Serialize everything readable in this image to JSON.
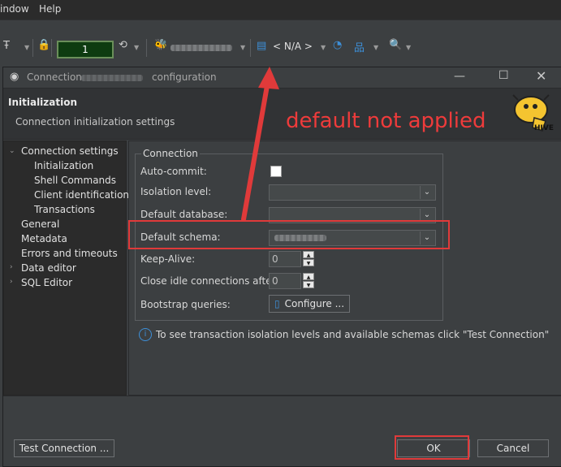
{
  "menu": {
    "items": [
      "indow",
      "Help"
    ]
  },
  "toolbar": {
    "counter_value": "1",
    "schema_label": "< N/A >"
  },
  "dialog": {
    "title_prefix": "Connection",
    "title_suffix": "configuration",
    "header_title": "Initialization",
    "header_subtitle": "Connection initialization settings",
    "logo_text": "HIVE"
  },
  "nav": {
    "items": [
      {
        "label": "Connection settings"
      },
      {
        "label": "Initialization"
      },
      {
        "label": "Shell Commands"
      },
      {
        "label": "Client identification"
      },
      {
        "label": "Transactions"
      },
      {
        "label": "General"
      },
      {
        "label": "Metadata"
      },
      {
        "label": "Errors and timeouts"
      },
      {
        "label": "Data editor"
      },
      {
        "label": "SQL Editor"
      }
    ]
  },
  "connection": {
    "group_label": "Connection",
    "auto_commit_label": "Auto-commit:",
    "isolation_label": "Isolation level:",
    "default_database_label": "Default database:",
    "default_schema_label": "Default schema:",
    "keepalive_label": "Keep-Alive:",
    "keepalive_value": "0",
    "close_idle_label": "Close idle connections after:",
    "close_idle_value": "0",
    "bootstrap_label": "Bootstrap queries:",
    "configure_button": "Configure ..."
  },
  "info_text": "To see transaction isolation levels and available schemas click \"Test Connection\"",
  "buttons": {
    "test_connection": "Test Connection ...",
    "ok": "OK",
    "cancel": "Cancel"
  },
  "annotation": {
    "text": "default not applied",
    "color": "#ee3b3b"
  },
  "colors": {
    "background": "#3c3f41",
    "nav_background": "#2b2b2b",
    "accent_blue": "#3d8fd8"
  }
}
